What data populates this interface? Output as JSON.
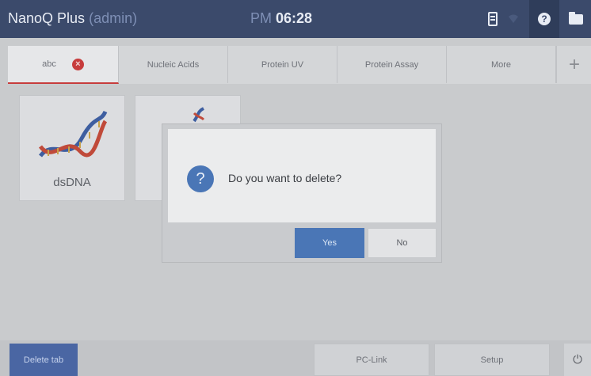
{
  "header": {
    "app_name": "NanoQ Plus",
    "user": "(admin)",
    "clock_ampm": "PM",
    "clock_time": "06:28"
  },
  "icons": [
    "battery-icon",
    "wifi-icon",
    "help-icon",
    "folder-icon",
    "close-tab-icon",
    "add-tab-icon",
    "question-icon",
    "power-icon",
    "dna-icon"
  ],
  "tabs": [
    {
      "label": "abc",
      "active": true
    },
    {
      "label": "Nucleic Acids"
    },
    {
      "label": "Protein UV"
    },
    {
      "label": "Protein Assay"
    },
    {
      "label": "More"
    }
  ],
  "add_tab_label": "+",
  "tiles": [
    {
      "label": "dsDNA"
    },
    {
      "label": ""
    }
  ],
  "dialog": {
    "message": "Do you want to delete?",
    "icon_glyph": "?",
    "yes_label": "Yes",
    "no_label": "No"
  },
  "bottom": {
    "delete_tab_label": "Delete tab",
    "pc_link_label": "PC-Link",
    "setup_label": "Setup",
    "power_glyph": "⏻"
  },
  "colors": {
    "header_bg": "#3b4a6b",
    "accent_blue": "#4a76b6",
    "close_red": "#c73c3c"
  }
}
